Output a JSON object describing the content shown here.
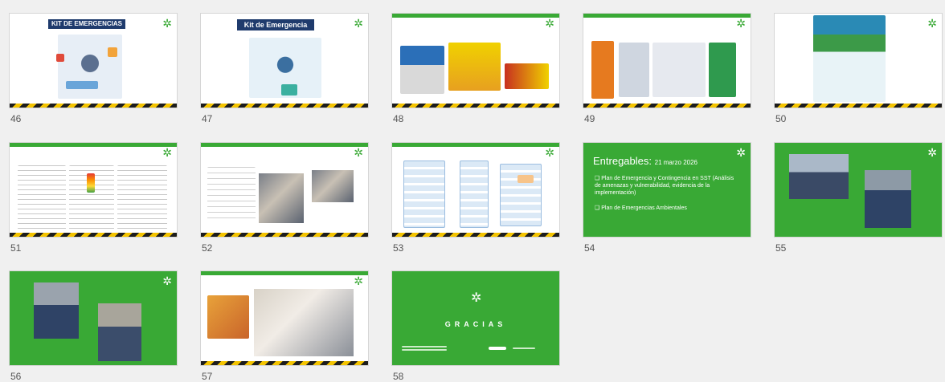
{
  "slides": [
    {
      "number": "46",
      "title": "KIT DE EMERGENCIAS"
    },
    {
      "number": "47",
      "title": "Kit de Emergencia"
    },
    {
      "number": "48"
    },
    {
      "number": "49"
    },
    {
      "number": "50"
    },
    {
      "number": "51"
    },
    {
      "number": "52"
    },
    {
      "number": "53"
    },
    {
      "number": "54",
      "title": "Entregables:",
      "date": "21 marzo 2026",
      "items": [
        "❑ Plan de Emergencia y Contingencia en SST (Análisis de amenazas y vulnerabilidad, evidencia de la implementación)",
        "❑ Plan de Emergencias Ambientales"
      ]
    },
    {
      "number": "55"
    },
    {
      "number": "56"
    },
    {
      "number": "57"
    },
    {
      "number": "58",
      "title": "GRACIAS"
    }
  ],
  "colors": {
    "accent_green": "#39a935",
    "banner_navy": "#1f3b6d",
    "hazard_yellow": "#f4c400"
  },
  "icons": {
    "logo": "sena-logo-icon"
  }
}
